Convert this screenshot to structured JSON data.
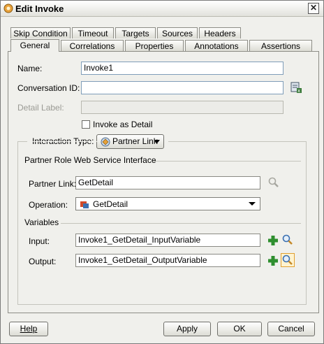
{
  "window": {
    "title": "Edit Invoke",
    "close_icon": "close-icon"
  },
  "tabs_row1": [
    "Skip Condition",
    "Timeout",
    "Targets",
    "Sources",
    "Headers"
  ],
  "tabs_row2": [
    "General",
    "Correlations",
    "Properties",
    "Annotations",
    "Assertions"
  ],
  "active_tab": "General",
  "form": {
    "name_label": "Name:",
    "name_value": "Invoke1",
    "conversation_label": "Conversation ID:",
    "conversation_value": "",
    "detail_label_label": "Detail Label:",
    "detail_label_value": "",
    "invoke_as_detail_label": "Invoke as Detail",
    "interaction_type_label": "Interaction Type:",
    "interaction_type_value": "Partner Link"
  },
  "partner_section": {
    "title": "Partner Role Web Service Interface",
    "partner_link_label": "Partner Link:",
    "partner_link_value": "GetDetail",
    "operation_label": "Operation:",
    "operation_value": "GetDetail"
  },
  "variables": {
    "title": "Variables",
    "input_label": "Input:",
    "input_value": "Invoke1_GetDetail_InputVariable",
    "output_label": "Output:",
    "output_value": "Invoke1_GetDetail_OutputVariable"
  },
  "buttons": {
    "help": "Help",
    "apply": "Apply",
    "ok": "OK",
    "cancel": "Cancel"
  },
  "colors": {
    "add_green": "#2f8f2f",
    "search_blue": "#3a6fb0",
    "operation_red": "#d04a2a"
  }
}
